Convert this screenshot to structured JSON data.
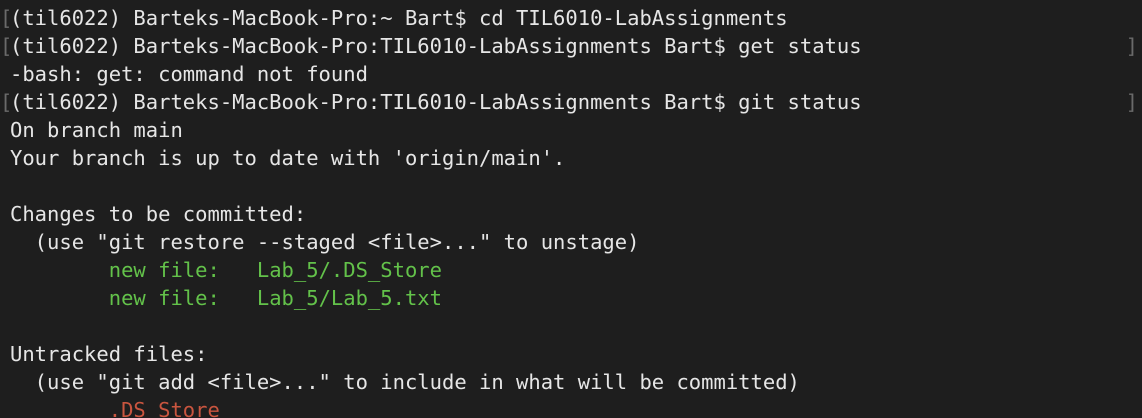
{
  "terminal": {
    "lines": [
      "(til6022) Barteks-MacBook-Pro:~ Bart$ cd TIL6010-LabAssignments",
      "(til6022) Barteks-MacBook-Pro:TIL6010-LabAssignments Bart$ get status",
      "-bash: get: command not found",
      "(til6022) Barteks-MacBook-Pro:TIL6010-LabAssignments Bart$ git status",
      "On branch main",
      "Your branch is up to date with 'origin/main'.",
      "",
      "Changes to be committed:",
      "  (use \"git restore --staged <file>...\" to unstage)",
      "\tnew file:   Lab_5/.DS_Store",
      "\tnew file:   Lab_5/Lab_5.txt",
      "",
      "Untracked files:",
      "  (use \"git add <file>...\" to include in what will be committed)",
      "\t.DS_Store"
    ],
    "line_colors": [
      "default",
      "default",
      "default",
      "default",
      "default",
      "default",
      "default",
      "default",
      "default",
      "green",
      "green",
      "default",
      "default",
      "default",
      "red"
    ],
    "left_marks": [
      "[",
      "[",
      "",
      "[",
      "",
      "",
      "",
      "",
      "",
      "",
      "",
      "",
      "",
      "",
      ""
    ],
    "right_marks": [
      "",
      "]",
      "",
      "]",
      "",
      "",
      "",
      "",
      "",
      "",
      "",
      "",
      "",
      "",
      ""
    ],
    "colors": {
      "background": "#1e1e1e",
      "foreground": "#e6e6e6",
      "green": "#63c24a",
      "red": "#c9553f",
      "marks": "#6a6a6a"
    }
  }
}
